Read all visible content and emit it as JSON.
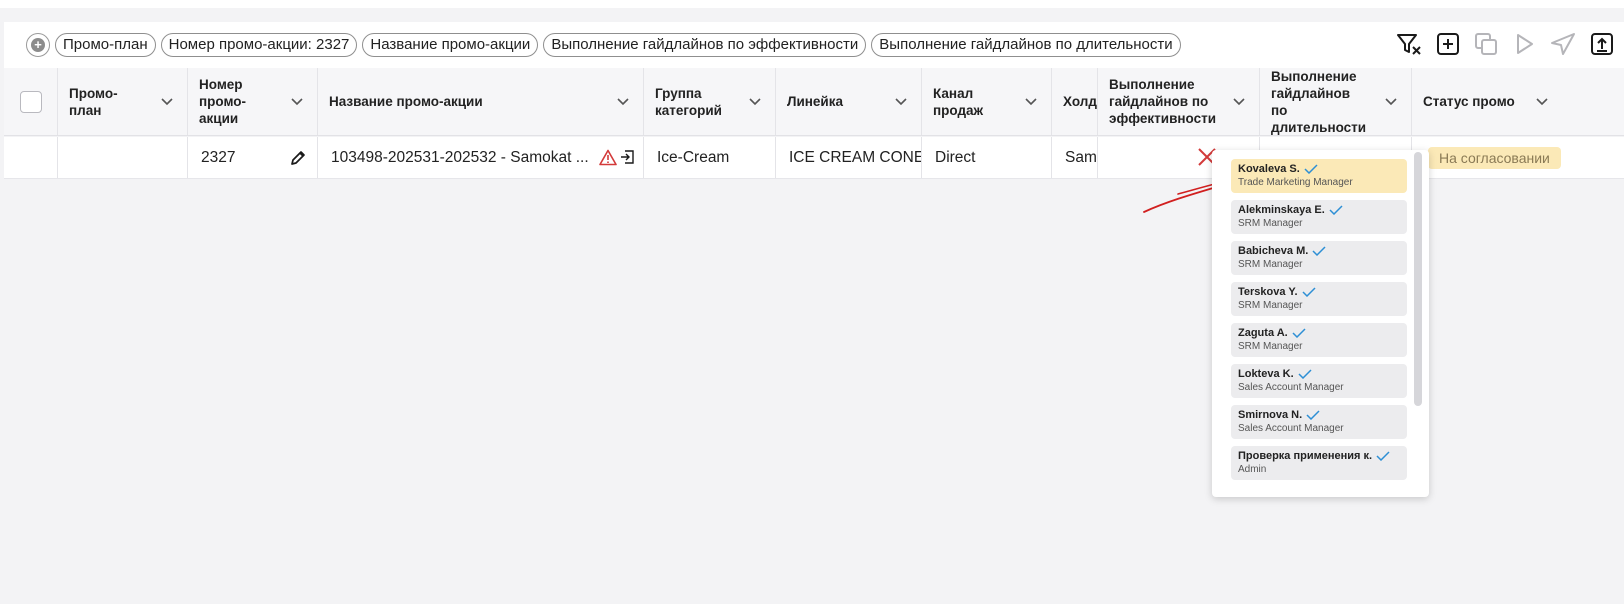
{
  "filters": {
    "chips": [
      "Промо-план",
      "Номер промо-акции: 2327",
      "Название промо-акции",
      "Выполнение гайдлайнов по эффективности",
      "Выполнение гайдлайнов по длительности"
    ]
  },
  "toolbar": {
    "icons": [
      "clear-filter-icon",
      "add-icon",
      "copy-icon",
      "play-icon",
      "send-icon",
      "export-icon"
    ]
  },
  "columns": {
    "promo_plan": "Промо-план",
    "promo_number": "Номер промо-акции",
    "promo_name": "Название промо-акции",
    "category_group": "Группа категорий",
    "line": "Линейка",
    "sales_channel": "Канал продаж",
    "holding": "Холд",
    "efficiency": "Выполнение гайдлайнов по эффективности",
    "duration": "Выполнение гайдлайнов по длительности",
    "status": "Статус промо"
  },
  "row": {
    "promo_plan": "",
    "promo_number": "2327",
    "promo_name": "103498-202531-202532 - Samokat ...",
    "category_group": "Ice-Cream",
    "line": "ICE CREAM CONE",
    "sales_channel": "Direct",
    "holding": "Sam",
    "status": "На согласовании"
  },
  "approvers": [
    {
      "name": "Kovaleva S.",
      "role": "Trade Marketing Manager",
      "active": true
    },
    {
      "name": "Alekminskaya E.",
      "role": "SRM Manager",
      "active": false
    },
    {
      "name": "Babicheva M.",
      "role": "SRM Manager",
      "active": false
    },
    {
      "name": "Terskova Y.",
      "role": "SRM Manager",
      "active": false
    },
    {
      "name": "Zaguta A.",
      "role": "SRM Manager",
      "active": false
    },
    {
      "name": "Lokteva K.",
      "role": "Sales Account Manager",
      "active": false
    },
    {
      "name": "Smirnova N.",
      "role": "Sales Account Manager",
      "active": false
    },
    {
      "name": "Проверка применения к.",
      "role": "Admin",
      "active": false
    }
  ],
  "colors": {
    "accent": "#1a1a1a",
    "status_bg": "#fbe9b7",
    "error": "#d33a3a",
    "check": "#2d8fd5"
  }
}
